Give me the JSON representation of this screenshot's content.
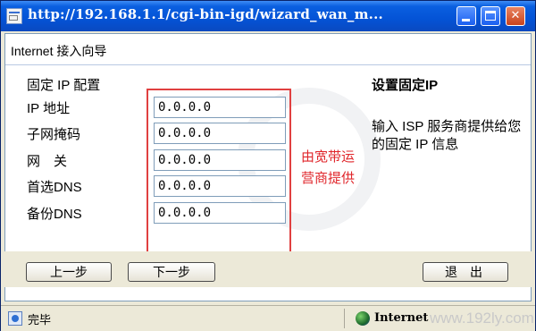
{
  "window": {
    "title": "http://192.168.1.1/cgi-bin-igd/wizard_wan_m...",
    "controls": {
      "minimize": "",
      "maximize": "",
      "close": "✕"
    }
  },
  "header": {
    "title": "Internet 接入向导"
  },
  "form": {
    "section_title": "固定 IP 配置",
    "fields": [
      {
        "label": "IP 地址",
        "value": "0.0.0.0"
      },
      {
        "label": "子网掩码",
        "value": "0.0.0.0"
      },
      {
        "label": "网　关",
        "value": "0.0.0.0"
      },
      {
        "label": "首选DNS",
        "value": "0.0.0.0"
      },
      {
        "label": "备份DNS",
        "value": "0.0.0.0"
      }
    ],
    "annotation_line1": "由宽带运",
    "annotation_line2": "营商提供"
  },
  "help": {
    "title": "设置固定IP",
    "description": "输入 ISP 服务商提供给您的固定 IP 信息"
  },
  "buttons": {
    "prev": "上一步",
    "next": "下一步",
    "exit": "退出"
  },
  "statusbar": {
    "status": "完毕",
    "zone": "Internet",
    "watermark": "www.192ly.com"
  }
}
